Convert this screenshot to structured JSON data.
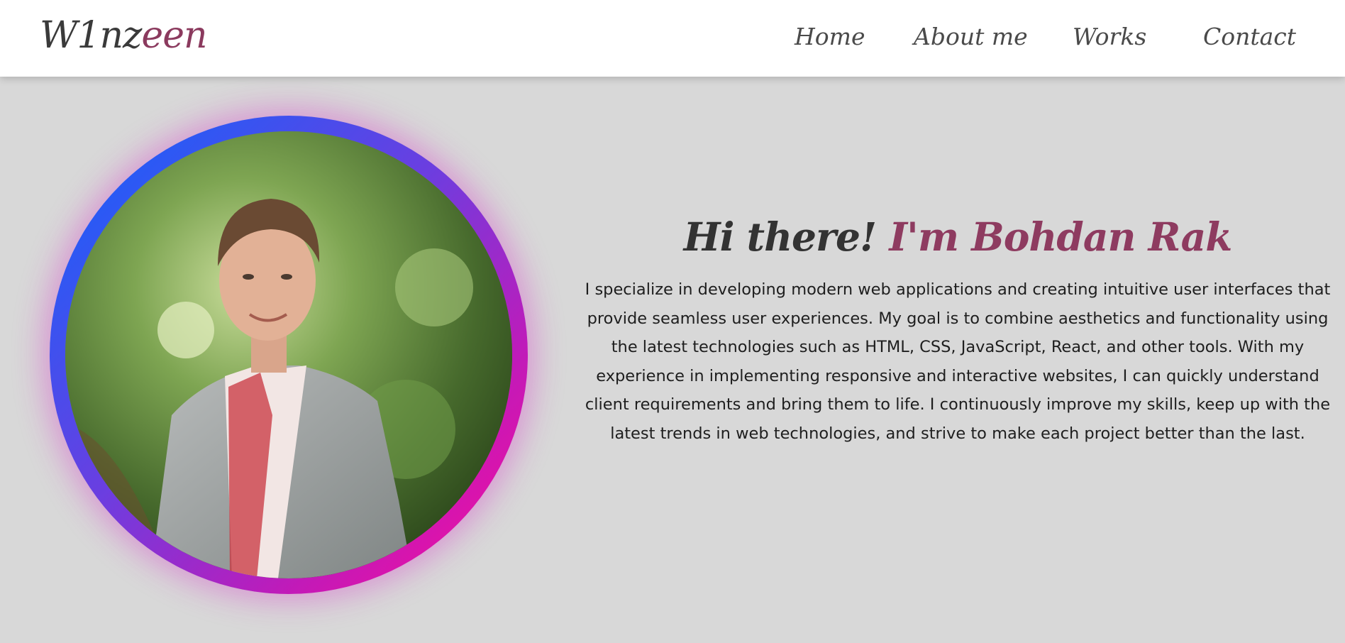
{
  "brand": {
    "logo_main": "W1nz",
    "logo_accent": "een",
    "accent_color": "#8b3a5e"
  },
  "nav": {
    "items": [
      {
        "label": "Home"
      },
      {
        "label": "About me"
      },
      {
        "label": "Works"
      },
      {
        "label": "Contact"
      }
    ]
  },
  "hero": {
    "greeting": "Hi there!",
    "name_intro": "I'm Bohdan Rak",
    "bio": "I specialize in developing modern web applications and creating intuitive user interfaces that provide seamless user experiences. My goal is to combine aesthetics and functionality using the latest technologies such as HTML, CSS, JavaScript, React, and other tools. With my experience in implementing responsive and interactive websites, I can quickly understand client requirements and bring them to life. I continuously improve my skills, keep up with the latest trends in web technologies, and strive to make each project better than the last.",
    "photo_icon": "portrait-photo",
    "ring_gradient": [
      "#0a67ff",
      "#ff0a9a"
    ]
  },
  "colors": {
    "background": "#d8d8d8",
    "navbar": "#ffffff",
    "heading": "#333333",
    "name": "#8e3b60"
  }
}
